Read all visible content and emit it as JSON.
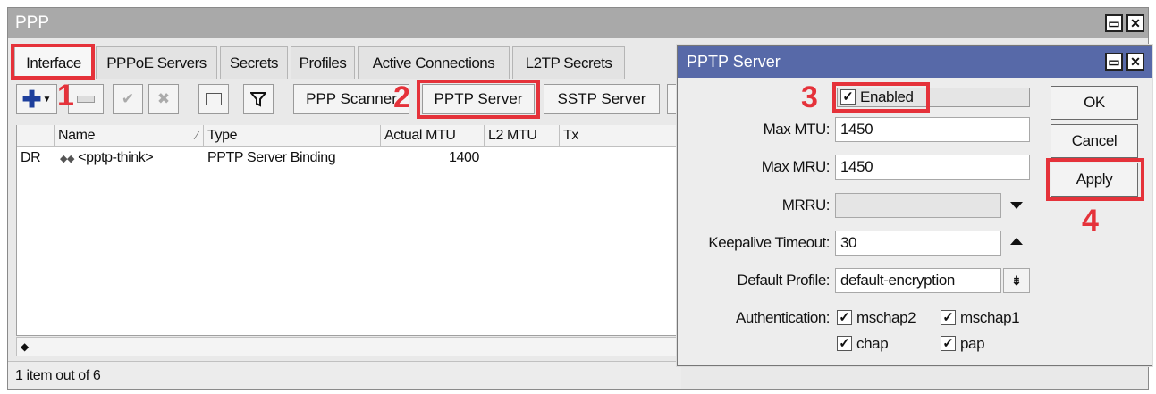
{
  "window": {
    "title": "PPP",
    "restore_icon": "restore-icon",
    "close_icon": "close-icon"
  },
  "tabs": [
    {
      "label": "Interface"
    },
    {
      "label": "PPPoE Servers"
    },
    {
      "label": "Secrets"
    },
    {
      "label": "Profiles"
    },
    {
      "label": "Active Connections"
    },
    {
      "label": "L2TP Secrets"
    }
  ],
  "toolbar": {
    "ppp_scanner": "PPP Scanner",
    "pptp_server": "PPTP Server",
    "sstp_server": "SSTP Server",
    "icons": [
      "add-icon",
      "remove-icon",
      "enable-icon",
      "disable-icon",
      "comment-icon",
      "filter-icon"
    ]
  },
  "table": {
    "columns": [
      "Name",
      "Type",
      "Actual MTU",
      "L2 MTU",
      "Tx"
    ],
    "rows": [
      {
        "flags": "DR",
        "name": "<pptp-think>",
        "type": "PPTP Server Binding",
        "actual_mtu": "1400",
        "l2_mtu": "",
        "tx": ""
      }
    ]
  },
  "status": {
    "text": "1 item out of 6"
  },
  "dialog": {
    "title": "PPTP Server",
    "enabled": {
      "label": "Enabled",
      "checked": true
    },
    "fields": {
      "max_mtu": {
        "label": "Max MTU:",
        "value": "1450"
      },
      "max_mru": {
        "label": "Max MRU:",
        "value": "1450"
      },
      "mrru": {
        "label": "MRRU:",
        "value": ""
      },
      "keepalive": {
        "label": "Keepalive Timeout:",
        "value": "30"
      },
      "default_profile": {
        "label": "Default Profile:",
        "value": "default-encryption"
      }
    },
    "authentication": {
      "label": "Authentication:",
      "options": [
        {
          "label": "mschap2",
          "checked": true
        },
        {
          "label": "mschap1",
          "checked": true
        },
        {
          "label": "chap",
          "checked": true
        },
        {
          "label": "pap",
          "checked": true
        }
      ]
    },
    "buttons": {
      "ok": "OK",
      "cancel": "Cancel",
      "apply": "Apply"
    }
  },
  "annotations": {
    "step1": "1",
    "step2": "2",
    "step3": "3",
    "step4": "4",
    "highlight_color": "#e5323a"
  }
}
